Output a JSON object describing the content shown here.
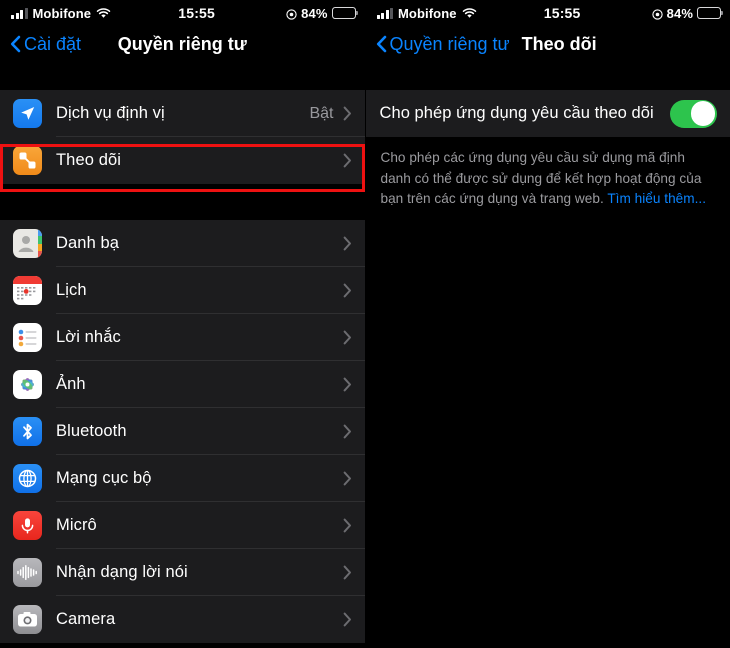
{
  "status_bar": {
    "carrier": "Mobifone",
    "time": "15:55",
    "battery_percent": "84%",
    "wifi_icon": "wifi-icon",
    "signal_icon": "signal-bars-icon",
    "location_icon": "location-services-icon",
    "battery_icon": "battery-icon"
  },
  "left_panel": {
    "nav": {
      "back_label": "Cài đặt",
      "title": "Quyền riêng tư",
      "back_icon": "chevron-left-icon"
    },
    "group_one": [
      {
        "label": "Dịch vụ định vị",
        "value": "Bật",
        "icon": "location-arrow-icon",
        "icon_class": "ic-location",
        "highlighted": false
      },
      {
        "label": "Theo dõi",
        "value": "",
        "icon": "tracking-nodes-icon",
        "icon_class": "ic-tracking",
        "highlighted": true
      }
    ],
    "group_two": [
      {
        "label": "Danh bạ",
        "value": "",
        "icon": "contacts-icon",
        "icon_class": "ic-contacts"
      },
      {
        "label": "Lịch",
        "value": "",
        "icon": "calendar-icon",
        "icon_class": "ic-calendar"
      },
      {
        "label": "Lời nhắc",
        "value": "",
        "icon": "reminders-icon",
        "icon_class": "ic-reminders"
      },
      {
        "label": "Ảnh",
        "value": "",
        "icon": "photos-icon",
        "icon_class": "ic-photos"
      },
      {
        "label": "Bluetooth",
        "value": "",
        "icon": "bluetooth-icon",
        "icon_class": "ic-bluetooth"
      },
      {
        "label": "Mạng cục bộ",
        "value": "",
        "icon": "globe-icon",
        "icon_class": "ic-network"
      },
      {
        "label": "Micrô",
        "value": "",
        "icon": "microphone-icon",
        "icon_class": "ic-micro"
      },
      {
        "label": "Nhận dạng lời nói",
        "value": "",
        "icon": "waveform-icon",
        "icon_class": "ic-speech"
      },
      {
        "label": "Camera",
        "value": "",
        "icon": "camera-icon",
        "icon_class": "ic-camera"
      }
    ]
  },
  "right_panel": {
    "nav": {
      "back_label": "Quyền riêng tư",
      "title": "Theo dõi",
      "back_icon": "chevron-left-icon"
    },
    "toggle": {
      "label": "Cho phép ứng dụng yêu cầu theo dõi",
      "state": "on"
    },
    "footnote": {
      "text": "Cho phép các ứng dụng yêu cầu sử dụng mã định danh có thể được sử dụng để kết hợp hoạt động của bạn trên các ứng dụng và trang web. ",
      "link": "Tìm hiểu thêm..."
    }
  },
  "annotation": {
    "highlight_color": "#ee1111",
    "target": "Theo dõi"
  }
}
